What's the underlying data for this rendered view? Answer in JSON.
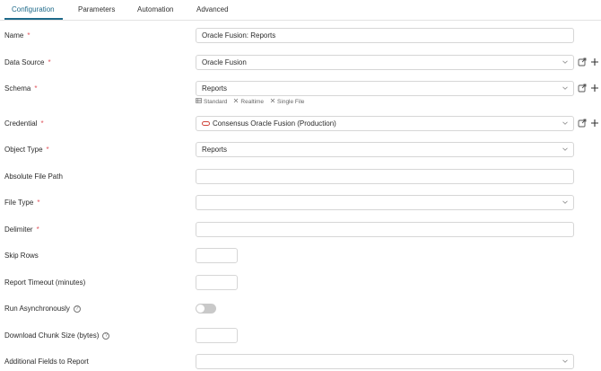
{
  "tabs": [
    {
      "label": "Configuration",
      "active": true
    },
    {
      "label": "Parameters",
      "active": false
    },
    {
      "label": "Automation",
      "active": false
    },
    {
      "label": "Advanced",
      "active": false
    }
  ],
  "form": {
    "name": {
      "label": "Name",
      "required": "*",
      "value": "Oracle Fusion: Reports"
    },
    "data_source": {
      "label": "Data Source",
      "required": "*",
      "value": "Oracle Fusion"
    },
    "schema": {
      "label": "Schema",
      "required": "*",
      "value": "Reports",
      "tags": [
        "Standard",
        "Realtime",
        "Single File"
      ]
    },
    "credential": {
      "label": "Credential",
      "required": "*",
      "value": "Consensus Oracle Fusion (Production)"
    },
    "object_type": {
      "label": "Object Type",
      "required": "*",
      "value": "Reports"
    },
    "absolute_file_path": {
      "label": "Absolute File Path",
      "value": ""
    },
    "file_type": {
      "label": "File Type",
      "required": "*",
      "value": ""
    },
    "delimiter": {
      "label": "Delimiter",
      "required": "*",
      "value": ""
    },
    "skip_rows": {
      "label": "Skip Rows",
      "value": ""
    },
    "report_timeout": {
      "label": "Report Timeout (minutes)",
      "value": ""
    },
    "run_async": {
      "label": "Run Asynchronously",
      "help": "?",
      "value": false
    },
    "chunk_size": {
      "label": "Download Chunk Size (bytes)",
      "help": "?",
      "value": ""
    },
    "additional_fields": {
      "label": "Additional Fields to Report",
      "value": ""
    }
  },
  "colors": {
    "accent": "#1e6a8a",
    "required": "#e0555d",
    "credential_icon": "#d0443a"
  }
}
